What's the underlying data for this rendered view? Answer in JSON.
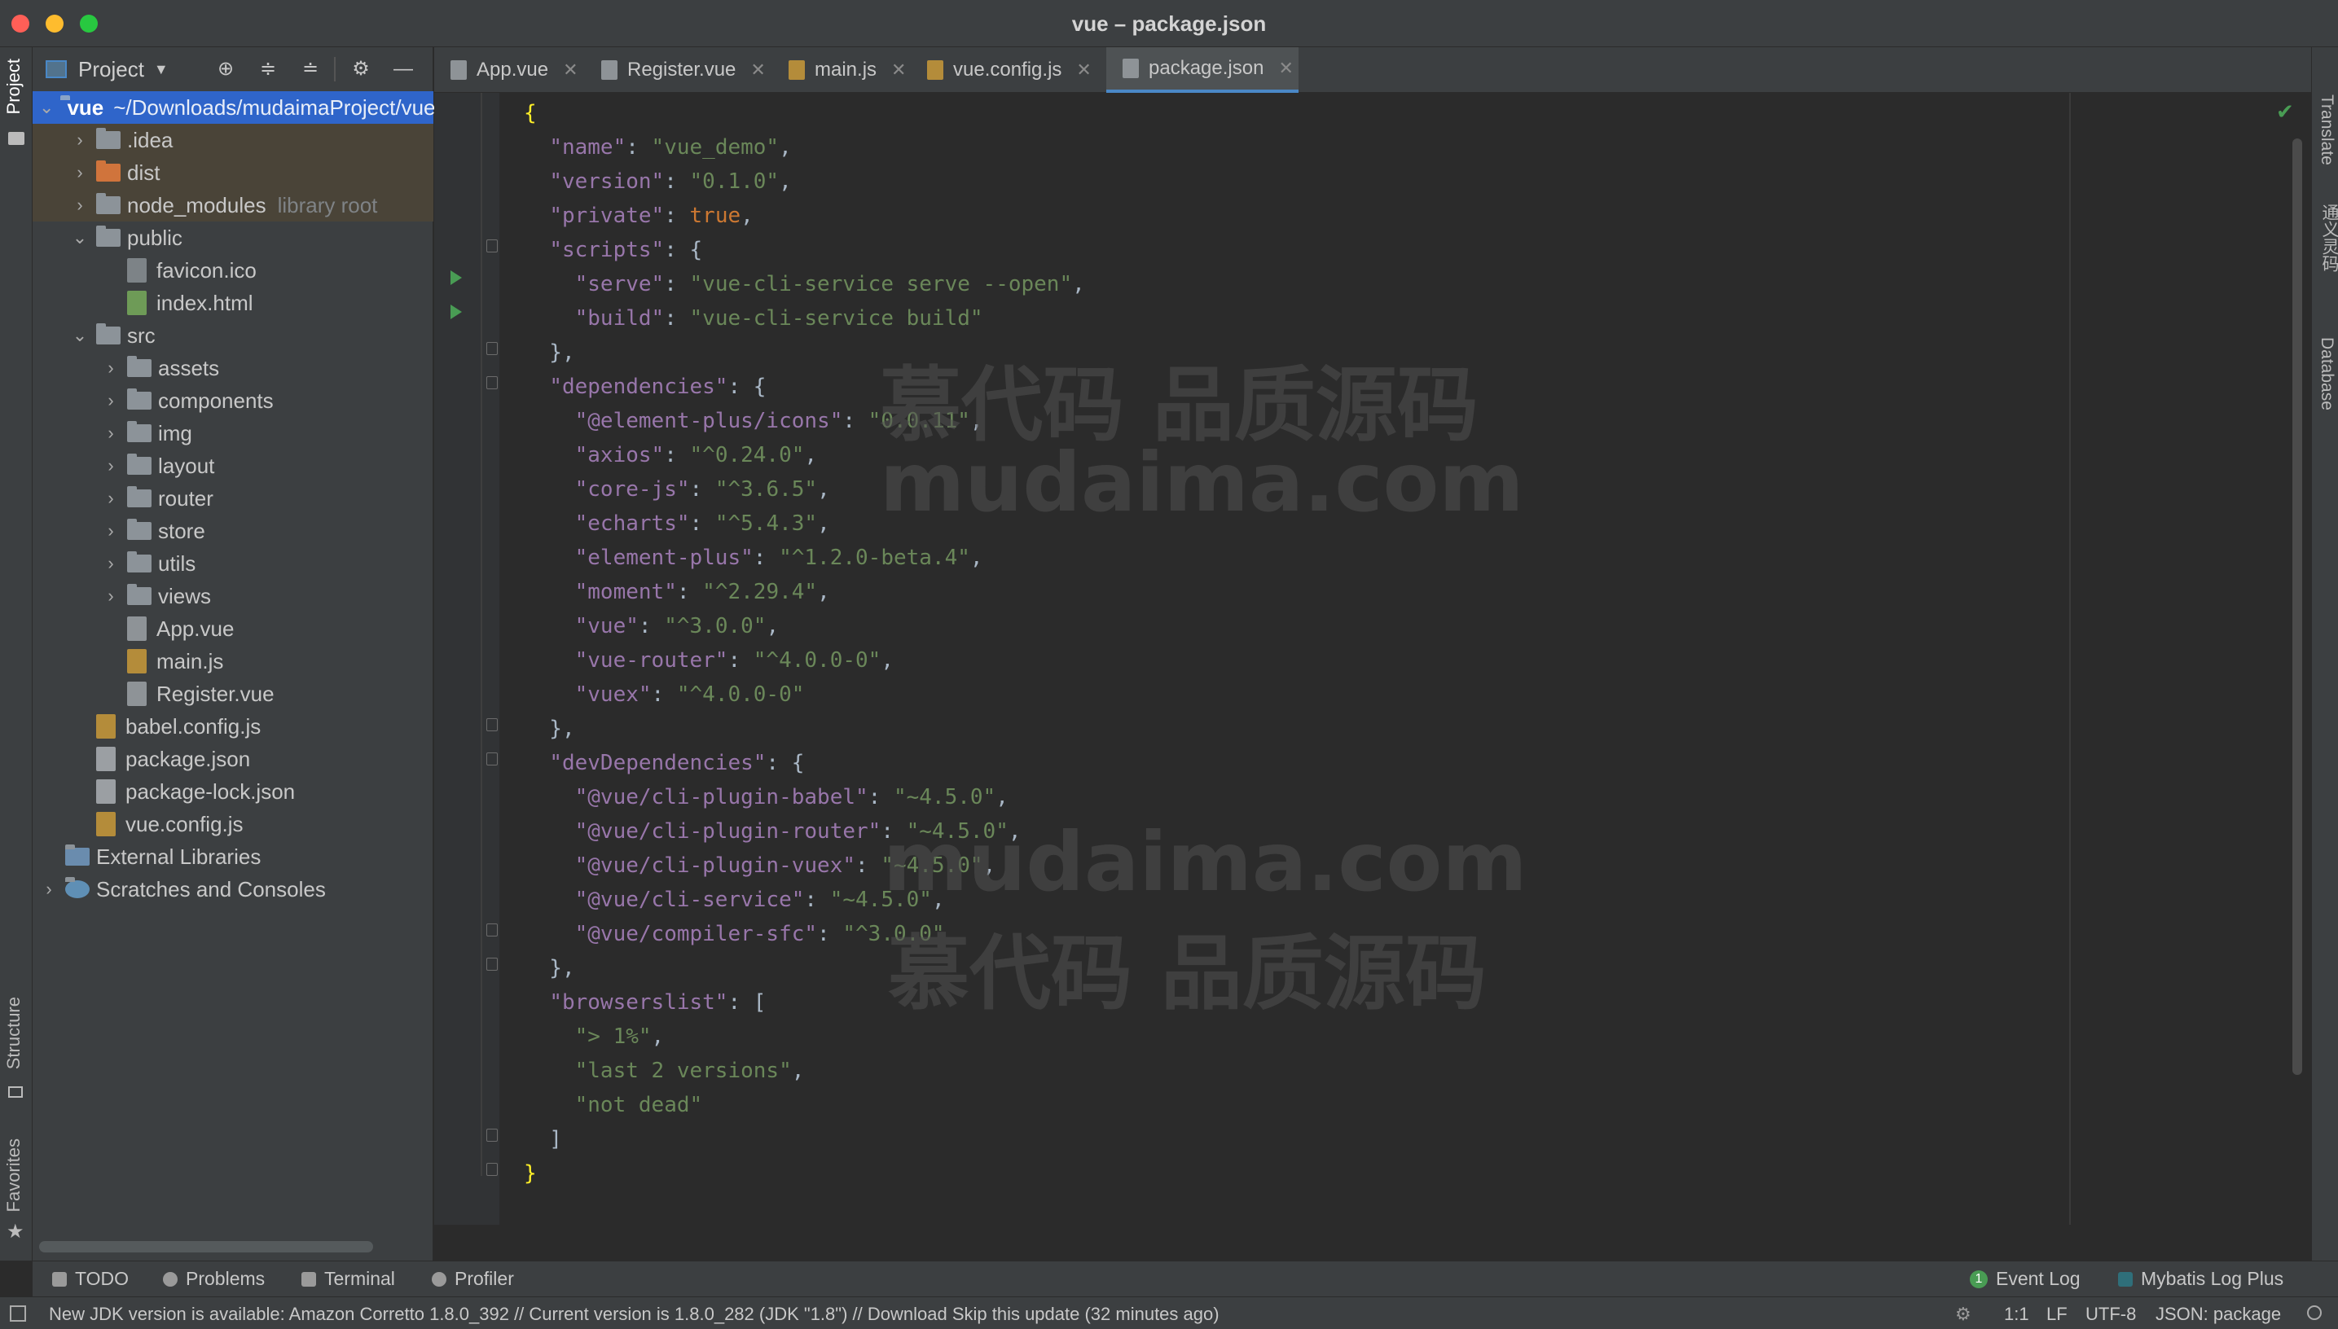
{
  "window": {
    "title": "vue – package.json"
  },
  "left_strip": {
    "project": "Project",
    "structure": "Structure",
    "favorites": "Favorites"
  },
  "project_panel": {
    "title": "Project",
    "tree": [
      {
        "label": "vue",
        "extra": "~/Downloads/mudaimaProject/vue",
        "kind": "folder-blue",
        "depth": 0,
        "chev": "v"
      },
      {
        "label": ".idea",
        "kind": "folder",
        "depth": 1,
        "chev": ">"
      },
      {
        "label": "dist",
        "kind": "folder-orange",
        "depth": 1,
        "chev": ">"
      },
      {
        "label": "node_modules",
        "extra": "library root",
        "kind": "folder",
        "depth": 1,
        "chev": ">"
      },
      {
        "label": "public",
        "kind": "folder",
        "depth": 1,
        "chev": "v"
      },
      {
        "label": "favicon.ico",
        "kind": "file",
        "depth": 2
      },
      {
        "label": "index.html",
        "kind": "file-html",
        "depth": 2
      },
      {
        "label": "src",
        "kind": "folder",
        "depth": 1,
        "chev": "v"
      },
      {
        "label": "assets",
        "kind": "folder",
        "depth": 2,
        "chev": ">"
      },
      {
        "label": "components",
        "kind": "folder",
        "depth": 2,
        "chev": ">"
      },
      {
        "label": "img",
        "kind": "folder",
        "depth": 2,
        "chev": ">"
      },
      {
        "label": "layout",
        "kind": "folder",
        "depth": 2,
        "chev": ">"
      },
      {
        "label": "router",
        "kind": "folder",
        "depth": 2,
        "chev": ">"
      },
      {
        "label": "store",
        "kind": "folder",
        "depth": 2,
        "chev": ">"
      },
      {
        "label": "utils",
        "kind": "folder",
        "depth": 2,
        "chev": ">"
      },
      {
        "label": "views",
        "kind": "folder",
        "depth": 2,
        "chev": ">"
      },
      {
        "label": "App.vue",
        "kind": "file-vue",
        "depth": 2
      },
      {
        "label": "main.js",
        "kind": "file-js",
        "depth": 2
      },
      {
        "label": "Register.vue",
        "kind": "file-vue",
        "depth": 2
      },
      {
        "label": "babel.config.js",
        "kind": "file-js",
        "depth": 1
      },
      {
        "label": "package.json",
        "kind": "file-json",
        "depth": 1
      },
      {
        "label": "package-lock.json",
        "kind": "file-json",
        "depth": 1
      },
      {
        "label": "vue.config.js",
        "kind": "file-js",
        "depth": 1
      },
      {
        "label": "External Libraries",
        "kind": "libs",
        "depth": 0
      },
      {
        "label": "Scratches and Consoles",
        "kind": "scratch",
        "depth": 0,
        "chev": ">"
      }
    ]
  },
  "tabs": [
    {
      "label": "App.vue",
      "icon": "vue"
    },
    {
      "label": "Register.vue",
      "icon": "vue"
    },
    {
      "label": "main.js",
      "icon": "js"
    },
    {
      "label": "vue.config.js",
      "icon": "js"
    },
    {
      "label": "package.json",
      "icon": "json",
      "active": true
    }
  ],
  "code_lines": [
    [
      [
        "ys",
        "{"
      ]
    ],
    [
      [
        "b",
        "  "
      ],
      [
        "k",
        "\"name\""
      ],
      [
        "b",
        ": "
      ],
      [
        "s",
        "\"vue_demo\""
      ],
      [
        "b",
        ","
      ]
    ],
    [
      [
        "b",
        "  "
      ],
      [
        "k",
        "\"version\""
      ],
      [
        "b",
        ": "
      ],
      [
        "s",
        "\"0.1.0\""
      ],
      [
        "b",
        ","
      ]
    ],
    [
      [
        "b",
        "  "
      ],
      [
        "k",
        "\"private\""
      ],
      [
        "b",
        ": "
      ],
      [
        "p",
        "true"
      ],
      [
        "b",
        ","
      ]
    ],
    [
      [
        "b",
        "  "
      ],
      [
        "k",
        "\"scripts\""
      ],
      [
        "b",
        ": {"
      ]
    ],
    [
      [
        "b",
        "    "
      ],
      [
        "k",
        "\"serve\""
      ],
      [
        "b",
        ": "
      ],
      [
        "s",
        "\"vue-cli-service serve --open\""
      ],
      [
        "b",
        ","
      ]
    ],
    [
      [
        "b",
        "    "
      ],
      [
        "k",
        "\"build\""
      ],
      [
        "b",
        ": "
      ],
      [
        "s",
        "\"vue-cli-service build\""
      ]
    ],
    [
      [
        "b",
        "  },"
      ]
    ],
    [
      [
        "b",
        "  "
      ],
      [
        "k",
        "\"dependencies\""
      ],
      [
        "b",
        ": {"
      ]
    ],
    [
      [
        "b",
        "    "
      ],
      [
        "k",
        "\"@element-plus/icons\""
      ],
      [
        "b",
        ": "
      ],
      [
        "s",
        "\"0.0.11\""
      ],
      [
        "b",
        ","
      ]
    ],
    [
      [
        "b",
        "    "
      ],
      [
        "k",
        "\"axios\""
      ],
      [
        "b",
        ": "
      ],
      [
        "s",
        "\"^0.24.0\""
      ],
      [
        "b",
        ","
      ]
    ],
    [
      [
        "b",
        "    "
      ],
      [
        "k",
        "\"core-js\""
      ],
      [
        "b",
        ": "
      ],
      [
        "s",
        "\"^3.6.5\""
      ],
      [
        "b",
        ","
      ]
    ],
    [
      [
        "b",
        "    "
      ],
      [
        "k",
        "\"echarts\""
      ],
      [
        "b",
        ": "
      ],
      [
        "s",
        "\"^5.4.3\""
      ],
      [
        "b",
        ","
      ]
    ],
    [
      [
        "b",
        "    "
      ],
      [
        "k",
        "\"element-plus\""
      ],
      [
        "b",
        ": "
      ],
      [
        "s",
        "\"^1.2.0-beta.4\""
      ],
      [
        "b",
        ","
      ]
    ],
    [
      [
        "b",
        "    "
      ],
      [
        "k",
        "\"moment\""
      ],
      [
        "b",
        ": "
      ],
      [
        "s",
        "\"^2.29.4\""
      ],
      [
        "b",
        ","
      ]
    ],
    [
      [
        "b",
        "    "
      ],
      [
        "k",
        "\"vue\""
      ],
      [
        "b",
        ": "
      ],
      [
        "s",
        "\"^3.0.0\""
      ],
      [
        "b",
        ","
      ]
    ],
    [
      [
        "b",
        "    "
      ],
      [
        "k",
        "\"vue-router\""
      ],
      [
        "b",
        ": "
      ],
      [
        "s",
        "\"^4.0.0-0\""
      ],
      [
        "b",
        ","
      ]
    ],
    [
      [
        "b",
        "    "
      ],
      [
        "k",
        "\"vuex\""
      ],
      [
        "b",
        ": "
      ],
      [
        "s",
        "\"^4.0.0-0\""
      ]
    ],
    [
      [
        "b",
        "  },"
      ]
    ],
    [
      [
        "b",
        "  "
      ],
      [
        "k",
        "\"devDependencies\""
      ],
      [
        "b",
        ": {"
      ]
    ],
    [
      [
        "b",
        "    "
      ],
      [
        "k",
        "\"@vue/cli-plugin-babel\""
      ],
      [
        "b",
        ": "
      ],
      [
        "s",
        "\"~4.5.0\""
      ],
      [
        "b",
        ","
      ]
    ],
    [
      [
        "b",
        "    "
      ],
      [
        "k",
        "\"@vue/cli-plugin-router\""
      ],
      [
        "b",
        ": "
      ],
      [
        "s",
        "\"~4.5.0\""
      ],
      [
        "b",
        ","
      ]
    ],
    [
      [
        "b",
        "    "
      ],
      [
        "k",
        "\"@vue/cli-plugin-vuex\""
      ],
      [
        "b",
        ": "
      ],
      [
        "s",
        "\"~4.5.0\""
      ],
      [
        "b",
        ","
      ]
    ],
    [
      [
        "b",
        "    "
      ],
      [
        "k",
        "\"@vue/cli-service\""
      ],
      [
        "b",
        ": "
      ],
      [
        "s",
        "\"~4.5.0\""
      ],
      [
        "b",
        ","
      ]
    ],
    [
      [
        "b",
        "    "
      ],
      [
        "k",
        "\"@vue/compiler-sfc\""
      ],
      [
        "b",
        ": "
      ],
      [
        "s",
        "\"^3.0.0\""
      ]
    ],
    [
      [
        "b",
        "  },"
      ]
    ],
    [
      [
        "b",
        "  "
      ],
      [
        "k",
        "\"browserslist\""
      ],
      [
        "b",
        ": ["
      ]
    ],
    [
      [
        "b",
        "    "
      ],
      [
        "s",
        "\"> 1%\""
      ],
      [
        "b",
        ","
      ]
    ],
    [
      [
        "b",
        "    "
      ],
      [
        "s",
        "\"last 2 versions\""
      ],
      [
        "b",
        ","
      ]
    ],
    [
      [
        "b",
        "    "
      ],
      [
        "s",
        "\"not dead\""
      ]
    ],
    [
      [
        "b",
        "  ]"
      ]
    ],
    [
      [
        "ys",
        "}"
      ]
    ]
  ],
  "watermarks": {
    "cn": "慕代码 品质源码",
    "en": "mudaima.com"
  },
  "right_strip": {
    "translate": "Translate",
    "tongyi": "通义灵码",
    "database": "Database"
  },
  "tool_windows": {
    "todo": "TODO",
    "problems": "Problems",
    "terminal": "Terminal",
    "profiler": "Profiler",
    "event_log": "Event Log",
    "event_log_count": "1",
    "mybatis": "Mybatis Log Plus"
  },
  "status": {
    "message": "New JDK version is available: Amazon Corretto 1.8.0_392 // Current version is 1.8.0_282 (JDK \"1.8\") // Download   Skip this update (32 minutes ago)",
    "position": "1:1",
    "line_sep": "LF",
    "encoding": "UTF-8",
    "schema": "JSON: package"
  },
  "colors": {
    "accent": "#4a88c7",
    "selection": "#2f65ca",
    "run": "#499c54"
  }
}
